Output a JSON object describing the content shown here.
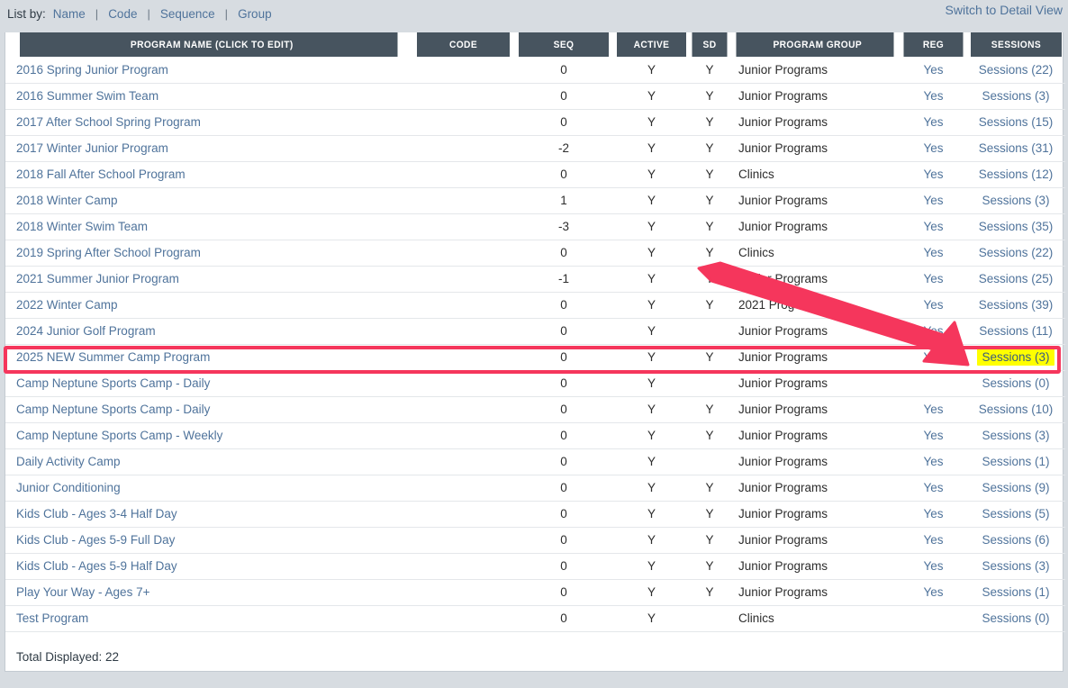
{
  "toolbar": {
    "list_by_label": "List by:",
    "separator": "|",
    "links": [
      {
        "label": "Name"
      },
      {
        "label": "Code"
      },
      {
        "label": "Sequence"
      },
      {
        "label": "Group"
      }
    ],
    "switch_view_label": "Switch to Detail View"
  },
  "table": {
    "columns": [
      {
        "key": "name",
        "label": "PROGRAM NAME (CLICK TO EDIT)"
      },
      {
        "key": "code",
        "label": "CODE"
      },
      {
        "key": "seq",
        "label": "SEQ"
      },
      {
        "key": "active",
        "label": "ACTIVE"
      },
      {
        "key": "sd",
        "label": "SD"
      },
      {
        "key": "group",
        "label": "PROGRAM GROUP"
      },
      {
        "key": "reg",
        "label": "REG"
      },
      {
        "key": "sessions",
        "label": "SESSIONS"
      }
    ],
    "rows": [
      {
        "name": "2016 Spring Junior Program",
        "code": "",
        "seq": "0",
        "active": "Y",
        "sd": "Y",
        "group": "Junior Programs",
        "reg": "Yes",
        "sessions": "Sessions (22)"
      },
      {
        "name": "2016 Summer Swim Team",
        "code": "",
        "seq": "0",
        "active": "Y",
        "sd": "Y",
        "group": "Junior Programs",
        "reg": "Yes",
        "sessions": "Sessions (3)"
      },
      {
        "name": "2017 After School Spring Program",
        "code": "",
        "seq": "0",
        "active": "Y",
        "sd": "Y",
        "group": "Junior Programs",
        "reg": "Yes",
        "sessions": "Sessions (15)"
      },
      {
        "name": "2017 Winter Junior Program",
        "code": "",
        "seq": "-2",
        "active": "Y",
        "sd": "Y",
        "group": "Junior Programs",
        "reg": "Yes",
        "sessions": "Sessions (31)"
      },
      {
        "name": "2018 Fall After School Program",
        "code": "",
        "seq": "0",
        "active": "Y",
        "sd": "Y",
        "group": "Clinics",
        "reg": "Yes",
        "sessions": "Sessions (12)"
      },
      {
        "name": "2018 Winter Camp",
        "code": "",
        "seq": "1",
        "active": "Y",
        "sd": "Y",
        "group": "Junior Programs",
        "reg": "Yes",
        "sessions": "Sessions (3)"
      },
      {
        "name": "2018 Winter Swim Team",
        "code": "",
        "seq": "-3",
        "active": "Y",
        "sd": "Y",
        "group": "Junior Programs",
        "reg": "Yes",
        "sessions": "Sessions (35)"
      },
      {
        "name": "2019 Spring After School Program",
        "code": "",
        "seq": "0",
        "active": "Y",
        "sd": "Y",
        "group": "Clinics",
        "reg": "Yes",
        "sessions": "Sessions (22)"
      },
      {
        "name": "2021 Summer Junior Program",
        "code": "",
        "seq": "-1",
        "active": "Y",
        "sd": "Y",
        "group": "Junior Programs",
        "reg": "Yes",
        "sessions": "Sessions (25)"
      },
      {
        "name": "2022 Winter Camp",
        "code": "",
        "seq": "0",
        "active": "Y",
        "sd": "Y",
        "group": "2021 Prog",
        "reg": "Yes",
        "sessions": "Sessions (39)"
      },
      {
        "name": "2024 Junior Golf Program",
        "code": "",
        "seq": "0",
        "active": "Y",
        "sd": "",
        "group": "Junior Programs",
        "reg": "Yes",
        "sessions": "Sessions (11)"
      },
      {
        "name": "2025 NEW Summer Camp Program",
        "code": "",
        "seq": "0",
        "active": "Y",
        "sd": "Y",
        "group": "Junior Programs",
        "reg": "Yes",
        "sessions": "Sessions (3)",
        "highlighted": true
      },
      {
        "name": "Camp Neptune Sports Camp - Daily",
        "code": "",
        "seq": "0",
        "active": "Y",
        "sd": "",
        "group": "Junior Programs",
        "reg": "",
        "sessions": "Sessions (0)"
      },
      {
        "name": "Camp Neptune Sports Camp - Daily",
        "code": "",
        "seq": "0",
        "active": "Y",
        "sd": "Y",
        "group": "Junior Programs",
        "reg": "Yes",
        "sessions": "Sessions (10)"
      },
      {
        "name": "Camp Neptune Sports Camp - Weekly",
        "code": "",
        "seq": "0",
        "active": "Y",
        "sd": "Y",
        "group": "Junior Programs",
        "reg": "Yes",
        "sessions": "Sessions (3)"
      },
      {
        "name": "Daily Activity Camp",
        "code": "",
        "seq": "0",
        "active": "Y",
        "sd": "",
        "group": "Junior Programs",
        "reg": "Yes",
        "sessions": "Sessions (1)"
      },
      {
        "name": "Junior Conditioning",
        "code": "",
        "seq": "0",
        "active": "Y",
        "sd": "Y",
        "group": "Junior Programs",
        "reg": "Yes",
        "sessions": "Sessions (9)"
      },
      {
        "name": "Kids Club - Ages 3-4 Half Day",
        "code": "",
        "seq": "0",
        "active": "Y",
        "sd": "Y",
        "group": "Junior Programs",
        "reg": "Yes",
        "sessions": "Sessions (5)"
      },
      {
        "name": "Kids Club - Ages 5-9 Full Day",
        "code": "",
        "seq": "0",
        "active": "Y",
        "sd": "Y",
        "group": "Junior Programs",
        "reg": "Yes",
        "sessions": "Sessions (6)"
      },
      {
        "name": "Kids Club - Ages 5-9 Half Day",
        "code": "",
        "seq": "0",
        "active": "Y",
        "sd": "Y",
        "group": "Junior Programs",
        "reg": "Yes",
        "sessions": "Sessions (3)"
      },
      {
        "name": "Play Your Way - Ages 7+",
        "code": "",
        "seq": "0",
        "active": "Y",
        "sd": "Y",
        "group": "Junior Programs",
        "reg": "Yes",
        "sessions": "Sessions (1)"
      },
      {
        "name": "Test Program",
        "code": "",
        "seq": "0",
        "active": "Y",
        "sd": "",
        "group": "Clinics",
        "reg": "",
        "sessions": "Sessions (0)"
      }
    ],
    "total_label": "Total Displayed: 22"
  },
  "annotations": {
    "highlight_rect_color": "#f5365c",
    "arrow_color": "#f5365c",
    "cell_highlight_color": "#ffff00",
    "target_cell_text": "Sessions (3)"
  },
  "colors": {
    "page_background": "#d7dce1",
    "header_background": "#47545f",
    "link": "#4f739b",
    "text": "#2d2d2d"
  }
}
